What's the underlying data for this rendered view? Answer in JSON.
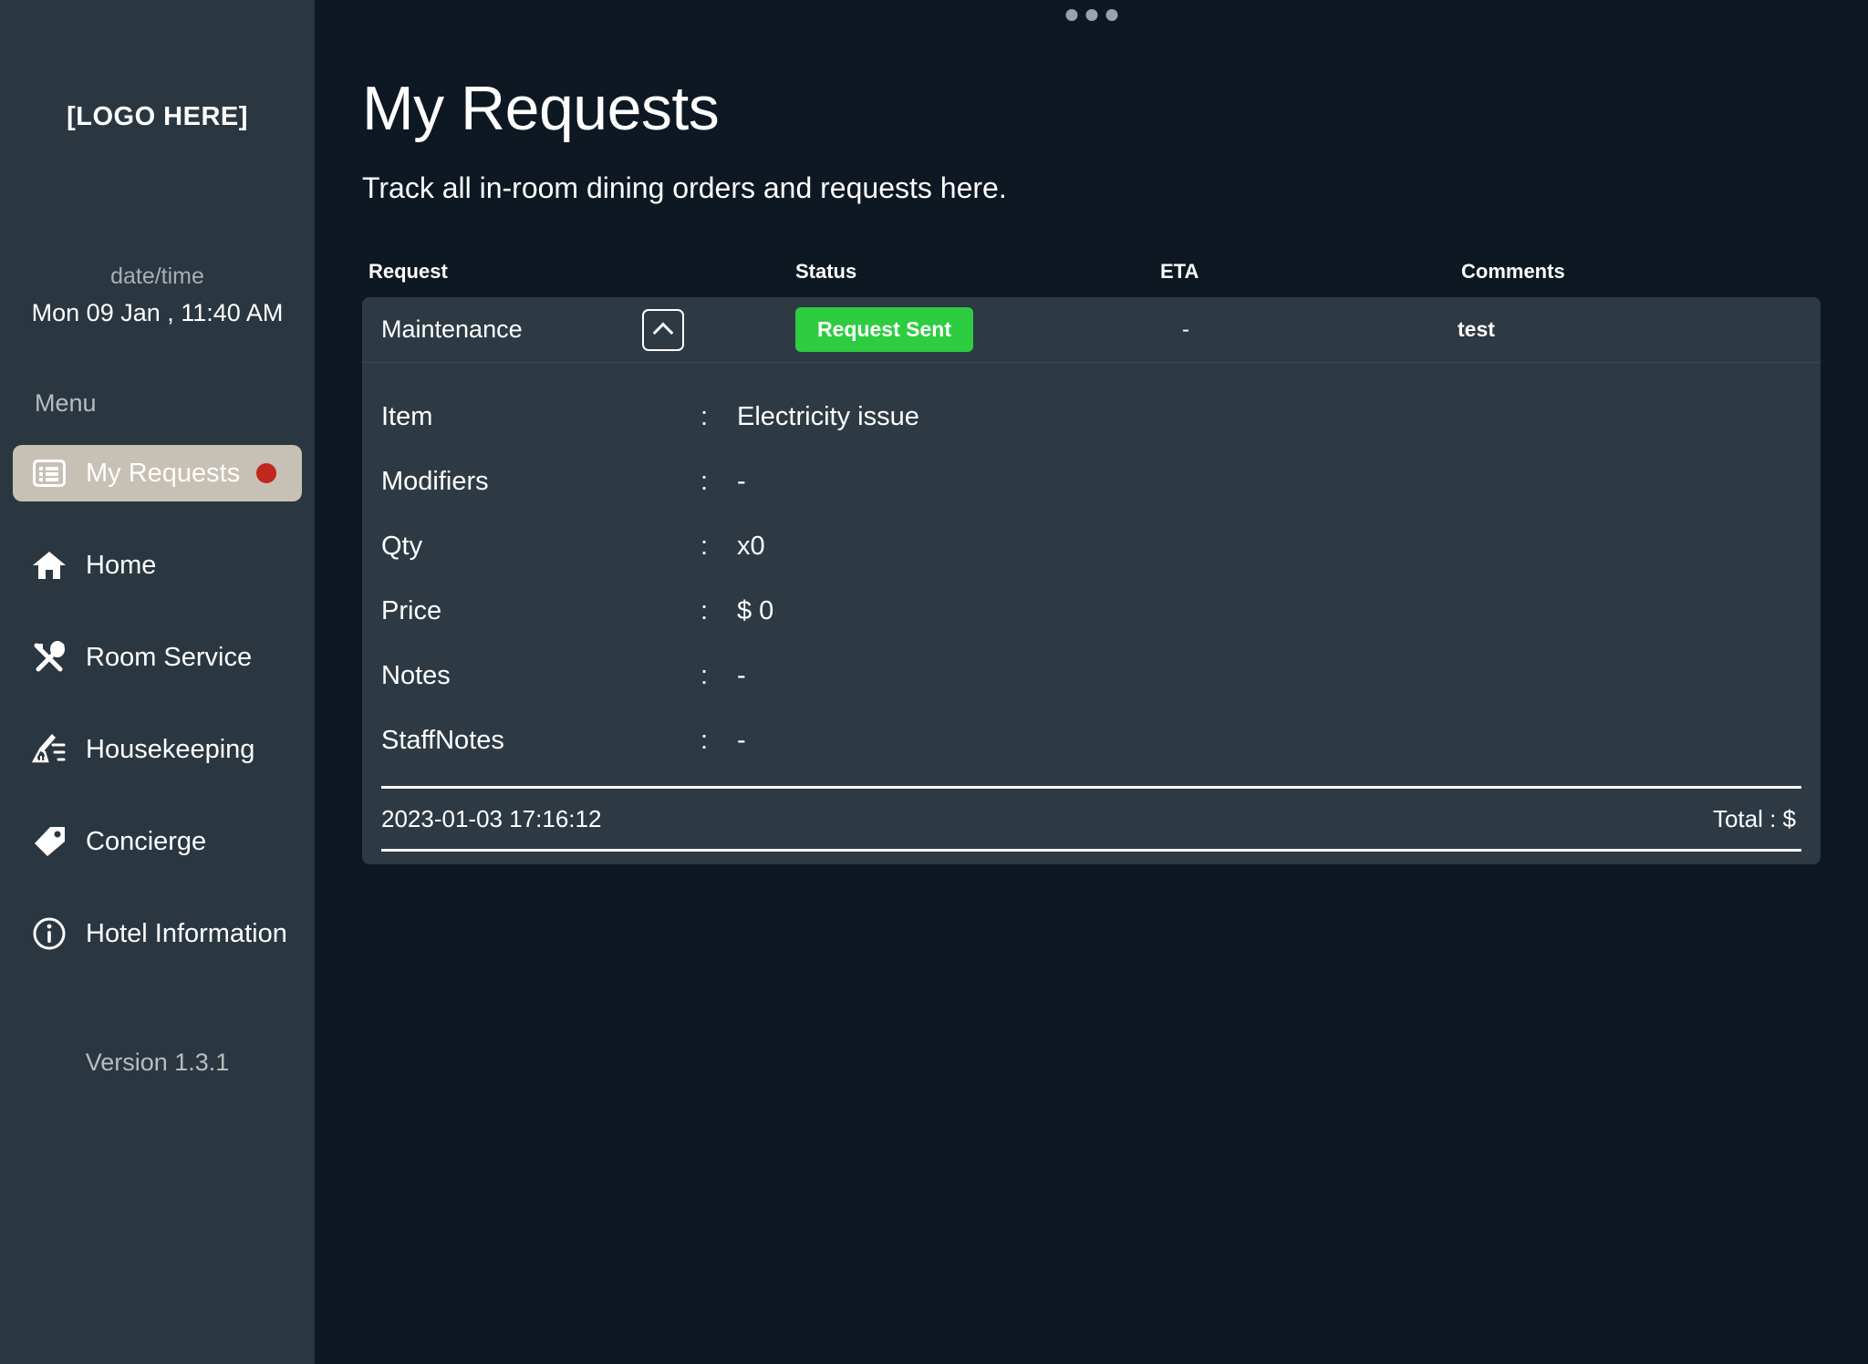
{
  "sidebar": {
    "logo": "[LOGO HERE]",
    "datetime_label": "date/time",
    "datetime_value": "Mon 09 Jan , 11:40 AM",
    "menu_label": "Menu",
    "version": "Version 1.3.1",
    "items": [
      {
        "label": "My Requests",
        "icon": "list-icon",
        "active": true,
        "badge": true
      },
      {
        "label": "Home",
        "icon": "home-icon",
        "active": false,
        "badge": false
      },
      {
        "label": "Room Service",
        "icon": "cutlery-icon",
        "active": false,
        "badge": false
      },
      {
        "label": "Housekeeping",
        "icon": "broom-icon",
        "active": false,
        "badge": false
      },
      {
        "label": "Concierge",
        "icon": "tag-icon",
        "active": false,
        "badge": false
      },
      {
        "label": "Hotel Information",
        "icon": "info-circle-icon",
        "active": false,
        "badge": false
      }
    ]
  },
  "main": {
    "title": "My Requests",
    "subtitle": "Track all in-room dining orders and requests here.",
    "columns": {
      "request": "Request",
      "status": "Status",
      "eta": "ETA",
      "comments": "Comments"
    },
    "request": {
      "name": "Maintenance",
      "status": "Request Sent",
      "eta": "-",
      "comments": "test",
      "expanded": true,
      "details": [
        {
          "label": "Item",
          "value": "Electricity issue"
        },
        {
          "label": "Modifiers",
          "value": "-"
        },
        {
          "label": "Qty",
          "value": "x0"
        },
        {
          "label": "Price",
          "value": "$ 0"
        },
        {
          "label": "Notes",
          "value": "-"
        },
        {
          "label": "StaffNotes",
          "value": "-"
        }
      ],
      "footer_date": "2023-01-03 17:16:12",
      "footer_total": "Total :   $"
    }
  },
  "colors": {
    "page_background": "#0e1823",
    "sidebar_background": "#2b3740",
    "card_background": "#2e3a43",
    "active_item": "#c7c0b4",
    "status_green": "#2ecc41",
    "badge_red": "#c0271f"
  }
}
